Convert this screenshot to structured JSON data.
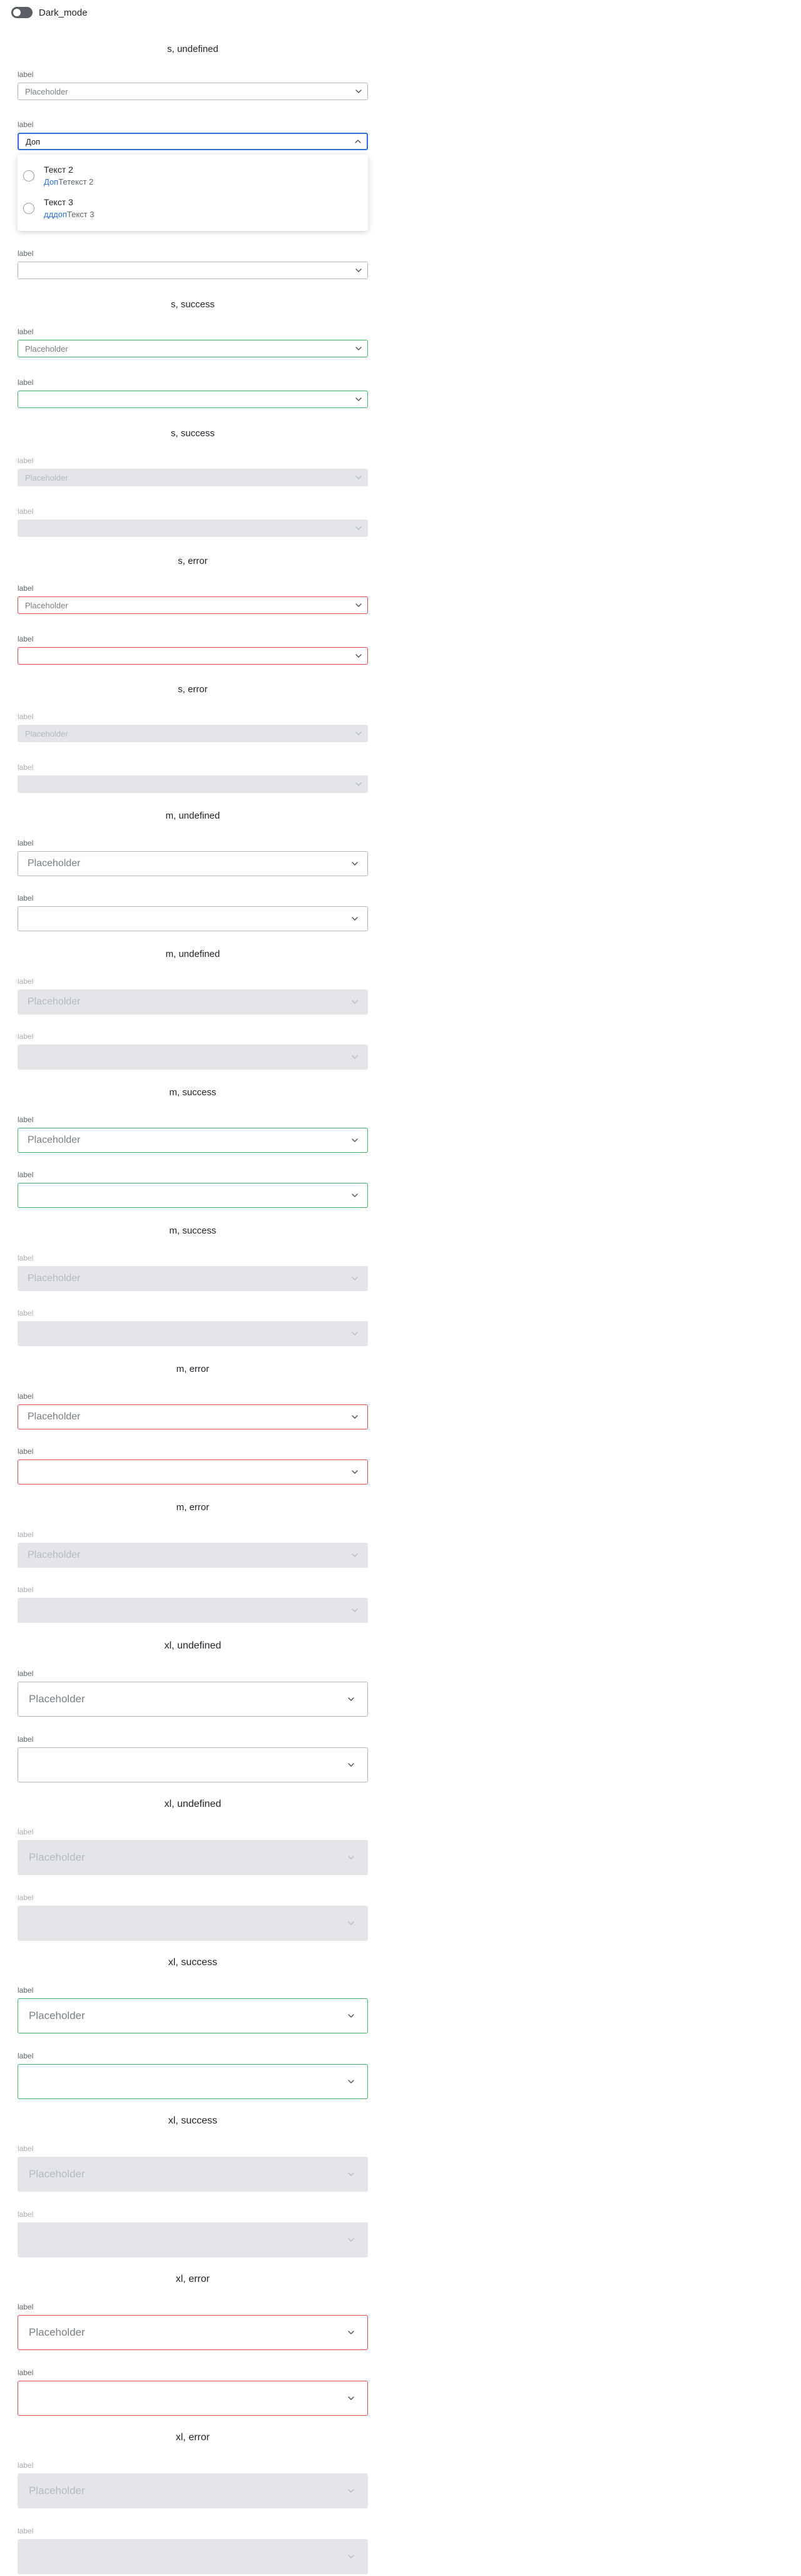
{
  "toggle": {
    "label": "Dark_mode",
    "checked": false
  },
  "options_dropdown": {
    "items": [
      {
        "title": "Текст 2",
        "sub_highlight": "Доп",
        "sub_rest": "Тетекст 2"
      },
      {
        "title": "Текст 3",
        "sub_highlight": "дддоп",
        "sub_rest": "Текст 3"
      }
    ]
  },
  "sections": [
    {
      "title": "s, undefined",
      "size": "s",
      "status": "undefined",
      "disabled": false,
      "fields": [
        {
          "label": "label",
          "value": "Placeholder"
        },
        {
          "label": "label",
          "value": "Доп",
          "focused": true
        },
        {
          "label": "label",
          "value": ""
        }
      ]
    },
    {
      "title": "s, success",
      "size": "s",
      "status": "success",
      "disabled": false,
      "fields": [
        {
          "label": "label",
          "value": "Placeholder"
        },
        {
          "label": "label",
          "value": ""
        }
      ]
    },
    {
      "title": "s, success",
      "size": "s",
      "status": "success",
      "disabled": true,
      "fields": [
        {
          "label": "label",
          "value": "Placeholder"
        },
        {
          "label": "label",
          "value": ""
        }
      ]
    },
    {
      "title": "s, error",
      "size": "s",
      "status": "error",
      "disabled": false,
      "fields": [
        {
          "label": "label",
          "value": "Placeholder"
        },
        {
          "label": "label",
          "value": ""
        }
      ]
    },
    {
      "title": "s, error",
      "size": "s",
      "status": "error",
      "disabled": true,
      "fields": [
        {
          "label": "label",
          "value": "Placeholder"
        },
        {
          "label": "label",
          "value": ""
        }
      ]
    },
    {
      "title": "m, undefined",
      "size": "m",
      "status": "undefined",
      "disabled": false,
      "fields": [
        {
          "label": "label",
          "value": "Placeholder"
        },
        {
          "label": "label",
          "value": ""
        }
      ]
    },
    {
      "title": "m, undefined",
      "size": "m",
      "status": "undefined",
      "disabled": true,
      "fields": [
        {
          "label": "label",
          "value": "Placeholder"
        },
        {
          "label": "label",
          "value": ""
        }
      ]
    },
    {
      "title": "m, success",
      "size": "m",
      "status": "success",
      "disabled": false,
      "fields": [
        {
          "label": "label",
          "value": "Placeholder"
        },
        {
          "label": "label",
          "value": ""
        }
      ]
    },
    {
      "title": "m, success",
      "size": "m",
      "status": "success",
      "disabled": true,
      "fields": [
        {
          "label": "label",
          "value": "Placeholder"
        },
        {
          "label": "label",
          "value": ""
        }
      ]
    },
    {
      "title": "m, error",
      "size": "m",
      "status": "error",
      "disabled": false,
      "fields": [
        {
          "label": "label",
          "value": "Placeholder"
        },
        {
          "label": "label",
          "value": ""
        }
      ]
    },
    {
      "title": "m, error",
      "size": "m",
      "status": "error",
      "disabled": true,
      "fields": [
        {
          "label": "label",
          "value": "Placeholder"
        },
        {
          "label": "label",
          "value": ""
        }
      ]
    },
    {
      "title": "xl, undefined",
      "size": "xl",
      "status": "undefined",
      "disabled": false,
      "fields": [
        {
          "label": "label",
          "value": "Placeholder"
        },
        {
          "label": "label",
          "value": ""
        }
      ]
    },
    {
      "title": "xl, undefined",
      "size": "xl",
      "status": "undefined",
      "disabled": true,
      "fields": [
        {
          "label": "label",
          "value": "Placeholder"
        },
        {
          "label": "label",
          "value": ""
        }
      ]
    },
    {
      "title": "xl, success",
      "size": "xl",
      "status": "success",
      "disabled": false,
      "fields": [
        {
          "label": "label",
          "value": "Placeholder"
        },
        {
          "label": "label",
          "value": ""
        }
      ]
    },
    {
      "title": "xl, success",
      "size": "xl",
      "status": "success",
      "disabled": true,
      "fields": [
        {
          "label": "label",
          "value": "Placeholder"
        },
        {
          "label": "label",
          "value": ""
        }
      ]
    },
    {
      "title": "xl, error",
      "size": "xl",
      "status": "error",
      "disabled": false,
      "fields": [
        {
          "label": "label",
          "value": "Placeholder"
        },
        {
          "label": "label",
          "value": ""
        }
      ]
    },
    {
      "title": "xl, error",
      "size": "xl",
      "status": "error",
      "disabled": true,
      "fields": [
        {
          "label": "label",
          "value": "Placeholder"
        },
        {
          "label": "label",
          "value": ""
        }
      ]
    }
  ],
  "colors": {
    "default_border": "#b3b8bf",
    "success_border": "#3fb56a",
    "error_border": "#e5484d",
    "focus_border": "#2d6fd6",
    "disabled_fill": "#e3e5e9"
  },
  "icons": {
    "select_arrow": "chevron-down-icon",
    "select_arrow_open": "chevron-up-icon"
  }
}
